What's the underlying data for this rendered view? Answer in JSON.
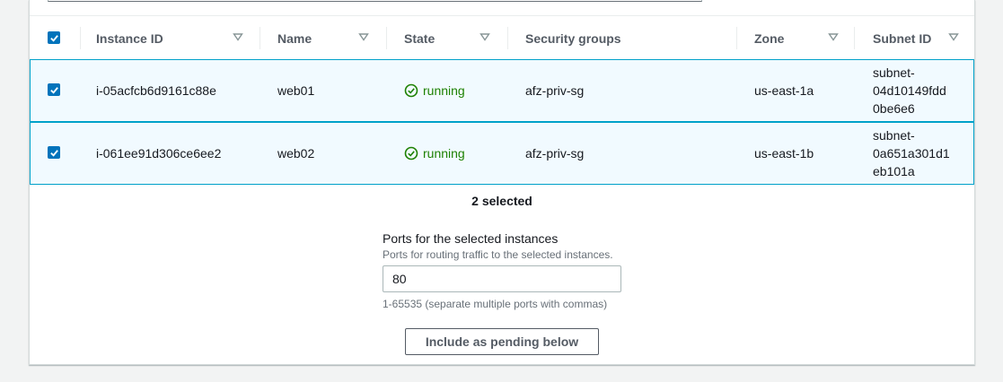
{
  "table": {
    "columns": [
      {
        "label": "Instance ID",
        "sortable": true
      },
      {
        "label": "Name",
        "sortable": true
      },
      {
        "label": "State",
        "sortable": true
      },
      {
        "label": "Security groups",
        "sortable": false
      },
      {
        "label": "Zone",
        "sortable": true
      },
      {
        "label": "Subnet ID",
        "sortable": true
      }
    ],
    "rows": [
      {
        "selected": true,
        "instance_id": "i-05acfcb6d9161c88e",
        "name": "web01",
        "state": "running",
        "security_groups": "afz-priv-sg",
        "zone": "us-east-1a",
        "subnet_lines": [
          "subnet-",
          "04d10149fdd",
          "0be6e6"
        ]
      },
      {
        "selected": true,
        "instance_id": "i-061ee91d306ce6ee2",
        "name": "web02",
        "state": "running",
        "security_groups": "afz-priv-sg",
        "zone": "us-east-1b",
        "subnet_lines": [
          "subnet-",
          "0a651a301d1",
          "eb101a"
        ]
      }
    ]
  },
  "selection": {
    "count_text": "2 selected"
  },
  "ports": {
    "label": "Ports for the selected instances",
    "description": "Ports for routing traffic to the selected instances.",
    "value": "80",
    "hint": "1-65535 (separate multiple ports with commas)"
  },
  "actions": {
    "include_label": "Include as pending below"
  },
  "colors": {
    "accent": "#0073bb",
    "selected_row_bg": "#f1faff",
    "selected_row_border": "#00a1c9",
    "running": "#1d8102"
  },
  "icons": {
    "sort": "sort-triangle-icon",
    "status": "check-circle-icon",
    "checkbox": "checkmark-icon"
  }
}
